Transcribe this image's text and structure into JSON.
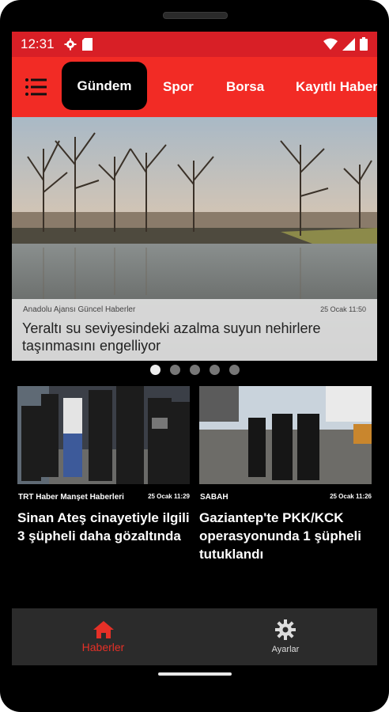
{
  "status": {
    "time": "12:31"
  },
  "appbar": {
    "tabs": [
      {
        "label": "Gündem"
      },
      {
        "label": "Spor"
      },
      {
        "label": "Borsa"
      },
      {
        "label": "Kayıtlı Haber"
      }
    ],
    "icon": "menu-icon"
  },
  "hero": {
    "source": "Anadolu Ajansı Güncel Haberler",
    "date": "25 Ocak 11:50",
    "title": "Yeraltı su seviyesindeki azalma suyun nehirlere taşınmasını engelliyor",
    "active_dot": 1,
    "dot_count": 5
  },
  "cards": [
    {
      "source": "TRT Haber Manşet Haberleri",
      "date": "25 Ocak 11:29",
      "title": "Sinan Ateş cinayetiyle ilgili 3 şüpheli daha gözaltında"
    },
    {
      "source": "SABAH",
      "date": "25 Ocak 11:26",
      "title": "Gaziantep'te PKK/KCK operasyonunda 1 şüpheli tutuklandı"
    }
  ],
  "bottom_nav": [
    {
      "label": "Haberler",
      "icon": "home-icon"
    },
    {
      "label": "Ayarlar",
      "icon": "gear-icon"
    }
  ],
  "colors": {
    "status_bar": "#d81f26",
    "app_bar": "#f22b25",
    "active_tab": "#000000",
    "nav_active": "#e63027"
  }
}
